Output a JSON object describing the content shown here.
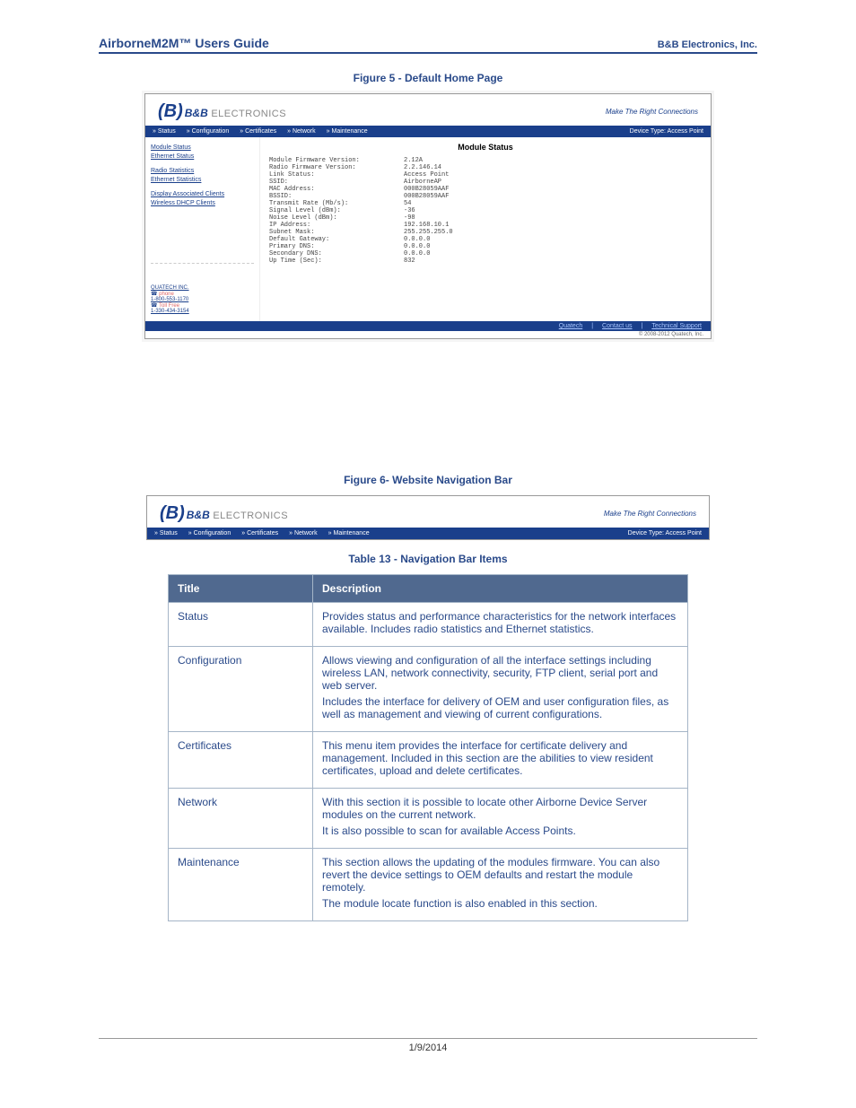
{
  "header": {
    "left": "AirborneM2M™ Users Guide",
    "right": "B&B Electronics, Inc."
  },
  "figure5": {
    "caption": "Figure 5 - Default Home Page",
    "logo": {
      "icon": "(B)",
      "brand": "B&B",
      "brand_suffix": " ELECTRONICS",
      "tagline": "Make The Right Connections"
    },
    "nav_prefix": "»",
    "nav": [
      "Status",
      "Configuration",
      "Certificates",
      "Network",
      "Maintenance"
    ],
    "device_type_label": "Device Type: Access Point",
    "sidebar_links": [
      "Module Status",
      "Ethernet Status",
      "Radio Statistics",
      "Ethernet Statistics",
      "Display Associated Clients",
      "Wireless DHCP Clients"
    ],
    "quatech_label": "QUATECH INC.",
    "toll_free": "Toll Free",
    "phone1": "1-800-553-1170",
    "phone_label": "phone",
    "phone2": "1-330-434-3154",
    "module_status_title": "Module Status",
    "status_rows": [
      [
        "Module Firmware Version:",
        "2.12A"
      ],
      [
        "Radio Firmware Version:",
        "2.2.146.14"
      ],
      [
        "Link Status:",
        "Access Point"
      ],
      [
        "SSID:",
        "AirborneAP"
      ],
      [
        "MAC Address:",
        "000B28059AAF"
      ],
      [
        "BSSID:",
        "000B28059AAF"
      ],
      [
        "Transmit Rate (Mb/s):",
        "54"
      ],
      [
        "Signal Level (dBm):",
        "-36"
      ],
      [
        "Noise Level (dBm):",
        "-98"
      ],
      [
        "IP Address:",
        "192.168.10.1"
      ],
      [
        "Subnet Mask:",
        "255.255.255.0"
      ],
      [
        "Default Gateway:",
        "0.0.0.0"
      ],
      [
        "Primary DNS:",
        "0.0.0.0"
      ],
      [
        "Secondary DNS:",
        "0.0.0.0"
      ],
      [
        "Up Time (Sec):",
        "832"
      ]
    ],
    "footer_links": [
      "Quatech",
      "Contact us",
      "Technical Support"
    ],
    "copyright": "© 2008-2012 Quatech, Inc."
  },
  "figure6": {
    "caption": "Figure 6- Website Navigation Bar"
  },
  "table13": {
    "caption": "Table 13 - Navigation Bar Items",
    "headers": [
      "Title",
      "Description"
    ],
    "rows": [
      {
        "title": "Status",
        "desc": [
          "Provides status and performance characteristics for the network interfaces available. Includes radio statistics and Ethernet statistics."
        ]
      },
      {
        "title": "Configuration",
        "desc": [
          "Allows viewing and configuration of all the interface settings including wireless LAN, network connectivity, security, FTP client, serial port and web server.",
          "Includes the interface for delivery of OEM and user configuration files, as well as management and viewing of current configurations."
        ]
      },
      {
        "title": "Certificates",
        "desc": [
          "This menu item provides the interface for certificate delivery and management. Included in this section are the abilities to view resident certificates, upload and delete certificates."
        ]
      },
      {
        "title": "Network",
        "desc": [
          "With this section it is possible to locate other Airborne Device Server modules on the current network.",
          "It is also possible to scan for available Access Points."
        ]
      },
      {
        "title": "Maintenance",
        "desc": [
          "This section allows the updating of the modules firmware. You can also revert the device settings to OEM defaults and restart the module remotely.",
          "The module locate function is also enabled in this section."
        ]
      }
    ]
  },
  "footer_date": "1/9/2014"
}
